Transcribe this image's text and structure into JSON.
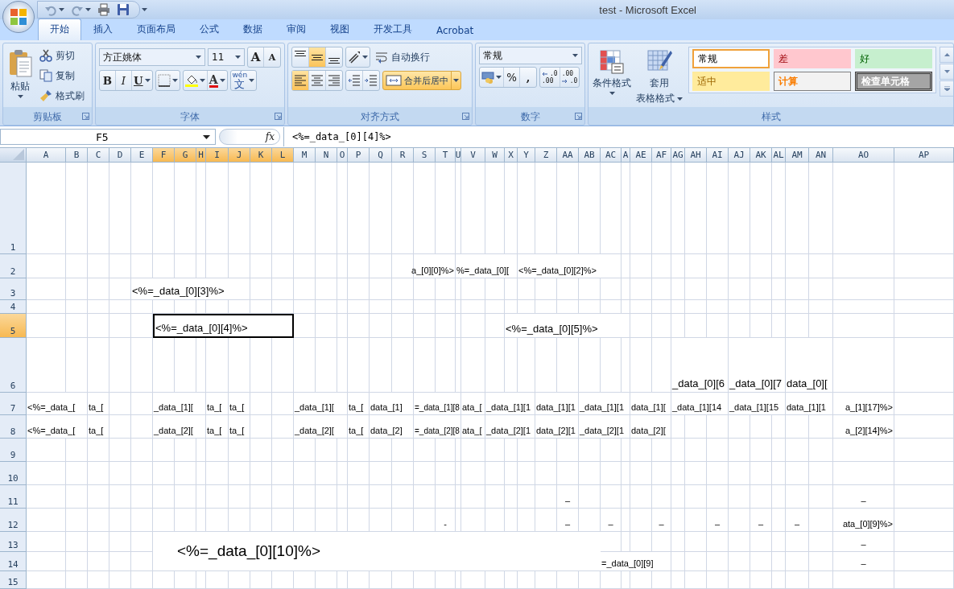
{
  "title_bar": {
    "title": "test - Microsoft Excel"
  },
  "tabs": [
    {
      "label": "开始",
      "selected": true
    },
    {
      "label": "插入",
      "selected": false
    },
    {
      "label": "页面布局",
      "selected": false
    },
    {
      "label": "公式",
      "selected": false
    },
    {
      "label": "数据",
      "selected": false
    },
    {
      "label": "审阅",
      "selected": false
    },
    {
      "label": "视图",
      "selected": false
    },
    {
      "label": "开发工具",
      "selected": false
    },
    {
      "label": "Acrobat",
      "selected": false
    }
  ],
  "ribbon": {
    "groups": [
      {
        "kind": "clipboard",
        "label": "剪贴板",
        "paste": "粘贴",
        "cut": "剪切",
        "copy": "复制",
        "format_painter": "格式刷"
      },
      {
        "kind": "font",
        "label": "字体",
        "font": "方正姚体",
        "size": "11",
        "grow": "A",
        "shrink": "A",
        "bold": "B",
        "italic": "I",
        "underline": "U",
        "font_color": "A",
        "phonetic": "文",
        "phonetic_ruby": "wén"
      },
      {
        "kind": "alignment",
        "label": "对齐方式",
        "vertical": [
          {
            "selected": false
          },
          {
            "selected": true
          },
          {
            "selected": false
          }
        ],
        "horizontal": [
          {
            "selected": true
          },
          {
            "selected": false
          },
          {
            "selected": false
          }
        ],
        "wrap": "自动换行",
        "merge": {
          "label": "合并后居中",
          "selected": true
        }
      },
      {
        "kind": "number",
        "label": "数字",
        "format": "常规",
        "percent": "%",
        "comma": ",",
        "increase_decimal": [
          ".0",
          ".00"
        ],
        "decrease_decimal": [
          ".00",
          ".0"
        ]
      },
      {
        "kind": "styles",
        "label": "样式",
        "conditional": "条件格式",
        "table": [
          "套用",
          "表格格式"
        ],
        "cell_styles": [
          {
            "label": "常规",
            "kind": "normal",
            "selected": true
          },
          {
            "label": "差",
            "kind": "bad",
            "selected": false
          },
          {
            "label": "好",
            "kind": "good",
            "selected": false
          },
          {
            "label": "适中",
            "kind": "neutral",
            "selected": false
          },
          {
            "label": "计算",
            "kind": "calculation",
            "selected": false
          },
          {
            "label": "检查单元格",
            "kind": "check",
            "selected": false
          }
        ]
      }
    ]
  },
  "formula_bar": {
    "name_box": "F5",
    "function_button": "fx",
    "formula": "<%=_data_[0][4]%>"
  },
  "sheet": {
    "columns": [
      {
        "label": "A",
        "selected": false
      },
      {
        "label": "B",
        "selected": false
      },
      {
        "label": "C",
        "selected": false
      },
      {
        "label": "D",
        "selected": false
      },
      {
        "label": "E",
        "selected": false
      },
      {
        "label": "F",
        "selected": true
      },
      {
        "label": "G",
        "selected": true
      },
      {
        "label": "H",
        "selected": true
      },
      {
        "label": "I",
        "selected": true
      },
      {
        "label": "J",
        "selected": true
      },
      {
        "label": "K",
        "selected": true
      },
      {
        "label": "L",
        "selected": true
      },
      {
        "label": "M",
        "selected": false
      },
      {
        "label": "N",
        "selected": false
      },
      {
        "label": "O",
        "selected": false
      },
      {
        "label": "P",
        "selected": false
      },
      {
        "label": "Q",
        "selected": false
      },
      {
        "label": "R",
        "selected": false
      },
      {
        "label": "S",
        "selected": false
      },
      {
        "label": "T",
        "selected": false
      },
      {
        "label": "U",
        "selected": false
      },
      {
        "label": "V",
        "selected": false
      },
      {
        "label": "W",
        "selected": false
      },
      {
        "label": "X",
        "selected": false
      },
      {
        "label": "Y",
        "selected": false
      },
      {
        "label": "Z",
        "selected": false
      },
      {
        "label": "AA",
        "selected": false
      },
      {
        "label": "AB",
        "selected": false
      },
      {
        "label": "AC",
        "selected": false
      },
      {
        "label": "A",
        "selected": false
      },
      {
        "label": "AE",
        "selected": false
      },
      {
        "label": "AF",
        "selected": false
      },
      {
        "label": "AG",
        "selected": false
      },
      {
        "label": "AH",
        "selected": false
      },
      {
        "label": "AI",
        "selected": false
      },
      {
        "label": "AJ",
        "selected": false
      },
      {
        "label": "AK",
        "selected": false
      },
      {
        "label": "AL",
        "selected": false
      },
      {
        "label": "AM",
        "selected": false
      },
      {
        "label": "AN",
        "selected": false
      },
      {
        "label": "AO",
        "selected": false
      },
      {
        "label": "AP",
        "selected": false
      }
    ],
    "rows": [
      {
        "label": "1",
        "selected": false
      },
      {
        "label": "2",
        "selected": false,
        "cells": [
          {
            "kind": "blank"
          },
          {
            "kind": "blank"
          },
          {
            "kind": "blank"
          },
          {
            "kind": "blank"
          },
          {
            "kind": "blank"
          },
          {
            "kind": "blank"
          },
          {
            "kind": "blank"
          },
          {
            "kind": "blank"
          },
          {
            "kind": "blank"
          },
          {
            "kind": "blank"
          },
          {
            "kind": "blank"
          },
          {
            "kind": "blank"
          },
          {
            "kind": "blank"
          },
          {
            "kind": "blank"
          },
          {
            "kind": "blank"
          },
          {
            "kind": "blank"
          },
          {
            "kind": "blank"
          },
          {
            "kind": "blank"
          },
          {
            "kind": "tail",
            "text": "a_[0][0]%>",
            "selected": false
          },
          {
            "kind": "span"
          },
          {
            "kind": "entry",
            "text": "%=_data_[0][",
            "selected": false
          },
          {
            "kind": "span"
          },
          {
            "kind": "span"
          },
          {
            "kind": "span"
          },
          {
            "kind": "entry",
            "text": "<%=_data_[0][2]%>",
            "selected": false
          },
          {
            "kind": "span"
          },
          {
            "kind": "span"
          },
          {
            "kind": "span"
          },
          {
            "kind": "span"
          }
        ]
      },
      {
        "label": "3",
        "selected": false,
        "cells": [
          {
            "kind": "blank"
          },
          {
            "kind": "blank"
          },
          {
            "kind": "blank"
          },
          {
            "kind": "blank"
          },
          {
            "kind": "label",
            "text": "<%=_data_[0][3]%>",
            "selected": false
          },
          {
            "kind": "span"
          },
          {
            "kind": "span"
          },
          {
            "kind": "span"
          },
          {
            "kind": "span"
          },
          {
            "kind": "span"
          }
        ]
      },
      {
        "label": "4",
        "selected": false
      },
      {
        "label": "5",
        "selected": true,
        "cells": [
          {
            "kind": "blank"
          },
          {
            "kind": "blank"
          },
          {
            "kind": "blank"
          },
          {
            "kind": "blank"
          },
          {
            "kind": "blank"
          },
          {
            "kind": "label",
            "text": "<%=_data_[0][4]%>",
            "selected": true
          },
          {
            "kind": "span"
          },
          {
            "kind": "span"
          },
          {
            "kind": "span"
          },
          {
            "kind": "span"
          },
          {
            "kind": "span"
          },
          {
            "kind": "span"
          },
          {
            "kind": "blank"
          },
          {
            "kind": "blank"
          },
          {
            "kind": "blank"
          },
          {
            "kind": "blank"
          },
          {
            "kind": "blank"
          },
          {
            "kind": "blank"
          },
          {
            "kind": "blank"
          },
          {
            "kind": "blank"
          },
          {
            "kind": "blank"
          },
          {
            "kind": "blank"
          },
          {
            "kind": "blank"
          },
          {
            "kind": "label",
            "text": "<%=_data_[0][5]%>",
            "selected": false
          },
          {
            "kind": "span"
          },
          {
            "kind": "span"
          },
          {
            "kind": "span"
          },
          {
            "kind": "span"
          },
          {
            "kind": "span"
          },
          {
            "kind": "span"
          }
        ]
      },
      {
        "label": "6",
        "selected": false,
        "cells": [
          {
            "kind": "blank"
          },
          {
            "kind": "blank"
          },
          {
            "kind": "blank"
          },
          {
            "kind": "blank"
          },
          {
            "kind": "blank"
          },
          {
            "kind": "blank"
          },
          {
            "kind": "blank"
          },
          {
            "kind": "blank"
          },
          {
            "kind": "blank"
          },
          {
            "kind": "blank"
          },
          {
            "kind": "blank"
          },
          {
            "kind": "blank"
          },
          {
            "kind": "blank"
          },
          {
            "kind": "blank"
          },
          {
            "kind": "blank"
          },
          {
            "kind": "blank"
          },
          {
            "kind": "blank"
          },
          {
            "kind": "blank"
          },
          {
            "kind": "blank"
          },
          {
            "kind": "blank"
          },
          {
            "kind": "blank"
          },
          {
            "kind": "blank"
          },
          {
            "kind": "blank"
          },
          {
            "kind": "blank"
          },
          {
            "kind": "blank"
          },
          {
            "kind": "blank"
          },
          {
            "kind": "blank"
          },
          {
            "kind": "blank"
          },
          {
            "kind": "blank"
          },
          {
            "kind": "blank"
          },
          {
            "kind": "blank"
          },
          {
            "kind": "blank"
          },
          {
            "kind": "label",
            "text": "_data_[0][6",
            "selected": false
          },
          {
            "kind": "span"
          },
          {
            "kind": "span"
          },
          {
            "kind": "label",
            "text": "_data_[0][7",
            "selected": false
          },
          {
            "kind": "span"
          },
          {
            "kind": "span"
          },
          {
            "kind": "label",
            "text": "data_[0][",
            "selected": false
          },
          {
            "kind": "span"
          }
        ]
      },
      {
        "label": "7",
        "selected": false,
        "cells": [
          {
            "kind": "entry",
            "text": "<%=_data_[",
            "selected": false
          },
          {
            "kind": "span"
          },
          {
            "kind": "entry",
            "text": "ta_[",
            "selected": false
          },
          {
            "kind": "blank"
          },
          {
            "kind": "blank"
          },
          {
            "kind": "entry",
            "text": "_data_[1][",
            "selected": false
          },
          {
            "kind": "span"
          },
          {
            "kind": "span"
          },
          {
            "kind": "entry",
            "text": "ta_[",
            "selected": false
          },
          {
            "kind": "entry",
            "text": "ta_[",
            "selected": false
          },
          {
            "kind": "blank"
          },
          {
            "kind": "blank"
          },
          {
            "kind": "entry",
            "text": "_data_[1][",
            "selected": false
          },
          {
            "kind": "span"
          },
          {
            "kind": "span"
          },
          {
            "kind": "entry",
            "text": "ta_[",
            "selected": false
          },
          {
            "kind": "entry",
            "text": "data_[1]",
            "selected": false
          },
          {
            "kind": "span"
          },
          {
            "kind": "small",
            "text": "=_data_[1][8",
            "selected": false
          },
          {
            "kind": "span"
          },
          {
            "kind": "span"
          },
          {
            "kind": "entry",
            "text": "ata_[",
            "selected": false
          },
          {
            "kind": "entry",
            "text": "_data_[1][1",
            "selected": false
          },
          {
            "kind": "span"
          },
          {
            "kind": "span"
          },
          {
            "kind": "entry",
            "text": "data_[1][1",
            "selected": false
          },
          {
            "kind": "span"
          },
          {
            "kind": "entry",
            "text": "_data_[1][1",
            "selected": false
          },
          {
            "kind": "span"
          },
          {
            "kind": "span"
          },
          {
            "kind": "entry",
            "text": "data_[1][",
            "selected": false
          },
          {
            "kind": "span"
          },
          {
            "kind": "entry",
            "text": "_data_[1][14",
            "selected": false
          },
          {
            "kind": "span"
          },
          {
            "kind": "span"
          },
          {
            "kind": "entry",
            "text": "_data_[1][15",
            "selected": false
          },
          {
            "kind": "span"
          },
          {
            "kind": "span"
          },
          {
            "kind": "entry",
            "text": "data_[1][1",
            "selected": false
          },
          {
            "kind": "span"
          },
          {
            "kind": "tail",
            "text": "a_[1][17]%>",
            "selected": false
          }
        ]
      },
      {
        "label": "8",
        "selected": false,
        "cells": [
          {
            "kind": "entry",
            "text": "<%=_data_[",
            "selected": false
          },
          {
            "kind": "span"
          },
          {
            "kind": "entry",
            "text": "ta_[",
            "selected": false
          },
          {
            "kind": "blank"
          },
          {
            "kind": "blank"
          },
          {
            "kind": "entry",
            "text": "_data_[2][",
            "selected": false
          },
          {
            "kind": "span"
          },
          {
            "kind": "span"
          },
          {
            "kind": "entry",
            "text": "ta_[",
            "selected": false
          },
          {
            "kind": "entry",
            "text": "ta_[",
            "selected": false
          },
          {
            "kind": "blank"
          },
          {
            "kind": "blank"
          },
          {
            "kind": "entry",
            "text": "_data_[2][",
            "selected": false
          },
          {
            "kind": "span"
          },
          {
            "kind": "span"
          },
          {
            "kind": "entry",
            "text": "ta_[",
            "selected": false
          },
          {
            "kind": "entry",
            "text": "data_[2]",
            "selected": false
          },
          {
            "kind": "span"
          },
          {
            "kind": "small",
            "text": "=_data_[2][8",
            "selected": false
          },
          {
            "kind": "span"
          },
          {
            "kind": "span"
          },
          {
            "kind": "entry",
            "text": "ata_[",
            "selected": false
          },
          {
            "kind": "entry",
            "text": "_data_[2][1",
            "selected": false
          },
          {
            "kind": "span"
          },
          {
            "kind": "span"
          },
          {
            "kind": "entry",
            "text": "data_[2][1",
            "selected": false
          },
          {
            "kind": "span"
          },
          {
            "kind": "entry",
            "text": "_data_[2][1",
            "selected": false
          },
          {
            "kind": "span"
          },
          {
            "kind": "span"
          },
          {
            "kind": "entry",
            "text": "data_[2][",
            "selected": false
          },
          {
            "kind": "span"
          },
          {
            "kind": "blank"
          },
          {
            "kind": "blank"
          },
          {
            "kind": "blank"
          },
          {
            "kind": "blank"
          },
          {
            "kind": "blank"
          },
          {
            "kind": "blank"
          },
          {
            "kind": "blank"
          },
          {
            "kind": "blank"
          },
          {
            "kind": "tail",
            "text": "a_[2][14]%>",
            "selected": false
          }
        ]
      },
      {
        "label": "9",
        "selected": false
      },
      {
        "label": "10",
        "selected": false
      },
      {
        "label": "11",
        "selected": false,
        "cells": [
          {
            "kind": "blank"
          },
          {
            "kind": "blank"
          },
          {
            "kind": "blank"
          },
          {
            "kind": "blank"
          },
          {
            "kind": "blank"
          },
          {
            "kind": "blank"
          },
          {
            "kind": "blank"
          },
          {
            "kind": "blank"
          },
          {
            "kind": "blank"
          },
          {
            "kind": "blank"
          },
          {
            "kind": "blank"
          },
          {
            "kind": "blank"
          },
          {
            "kind": "blank"
          },
          {
            "kind": "blank"
          },
          {
            "kind": "blank"
          },
          {
            "kind": "blank"
          },
          {
            "kind": "blank"
          },
          {
            "kind": "blank"
          },
          {
            "kind": "blank"
          },
          {
            "kind": "blank"
          },
          {
            "kind": "blank"
          },
          {
            "kind": "blank"
          },
          {
            "kind": "blank"
          },
          {
            "kind": "blank"
          },
          {
            "kind": "blank"
          },
          {
            "kind": "blank"
          },
          {
            "kind": "dash",
            "text": "–",
            "selected": false
          },
          {
            "kind": "blank"
          },
          {
            "kind": "blank"
          },
          {
            "kind": "blank"
          },
          {
            "kind": "blank"
          },
          {
            "kind": "blank"
          },
          {
            "kind": "blank"
          },
          {
            "kind": "blank"
          },
          {
            "kind": "blank"
          },
          {
            "kind": "blank"
          },
          {
            "kind": "blank"
          },
          {
            "kind": "blank"
          },
          {
            "kind": "blank"
          },
          {
            "kind": "blank"
          },
          {
            "kind": "dash",
            "text": "–",
            "selected": false
          }
        ]
      },
      {
        "label": "12",
        "selected": false,
        "cells": [
          {
            "kind": "blank"
          },
          {
            "kind": "blank"
          },
          {
            "kind": "blank"
          },
          {
            "kind": "blank"
          },
          {
            "kind": "blank"
          },
          {
            "kind": "blank"
          },
          {
            "kind": "blank"
          },
          {
            "kind": "blank"
          },
          {
            "kind": "blank"
          },
          {
            "kind": "blank"
          },
          {
            "kind": "blank"
          },
          {
            "kind": "blank"
          },
          {
            "kind": "blank"
          },
          {
            "kind": "blank"
          },
          {
            "kind": "blank"
          },
          {
            "kind": "blank"
          },
          {
            "kind": "blank"
          },
          {
            "kind": "blank"
          },
          {
            "kind": "blank"
          },
          {
            "kind": "dash",
            "text": "-",
            "selected": false
          },
          {
            "kind": "blank"
          },
          {
            "kind": "blank"
          },
          {
            "kind": "blank"
          },
          {
            "kind": "blank"
          },
          {
            "kind": "blank"
          },
          {
            "kind": "blank"
          },
          {
            "kind": "dash",
            "text": "–",
            "selected": false
          },
          {
            "kind": "blank"
          },
          {
            "kind": "dash",
            "text": "–",
            "selected": false
          },
          {
            "kind": "blank"
          },
          {
            "kind": "blank"
          },
          {
            "kind": "dash",
            "text": "–",
            "selected": false
          },
          {
            "kind": "blank"
          },
          {
            "kind": "blank"
          },
          {
            "kind": "dash",
            "text": "–",
            "selected": false
          },
          {
            "kind": "blank"
          },
          {
            "kind": "dash",
            "text": "–",
            "selected": false
          },
          {
            "kind": "blank"
          },
          {
            "kind": "dash",
            "text": "–",
            "selected": false
          },
          {
            "kind": "blank"
          },
          {
            "kind": "tail",
            "text": "ata_[0][9]%>",
            "selected": false
          }
        ]
      },
      {
        "label": "13",
        "selected": false,
        "cells": [
          {
            "kind": "blank"
          },
          {
            "kind": "blank"
          },
          {
            "kind": "blank"
          },
          {
            "kind": "blank"
          },
          {
            "kind": "blank"
          },
          {
            "kind": "title",
            "text": "<%=_data_[0][10]%>",
            "selected": false
          },
          {
            "kind": "span"
          },
          {
            "kind": "span"
          },
          {
            "kind": "span"
          },
          {
            "kind": "span"
          },
          {
            "kind": "span"
          },
          {
            "kind": "span"
          },
          {
            "kind": "span"
          },
          {
            "kind": "span"
          },
          {
            "kind": "span"
          },
          {
            "kind": "span"
          },
          {
            "kind": "span"
          },
          {
            "kind": "span"
          },
          {
            "kind": "span"
          },
          {
            "kind": "span"
          },
          {
            "kind": "span"
          },
          {
            "kind": "span"
          },
          {
            "kind": "span"
          },
          {
            "kind": "span"
          },
          {
            "kind": "span"
          },
          {
            "kind": "span"
          },
          {
            "kind": "span"
          },
          {
            "kind": "span"
          },
          {
            "kind": "blank"
          },
          {
            "kind": "blank"
          },
          {
            "kind": "blank"
          },
          {
            "kind": "blank"
          },
          {
            "kind": "blank"
          },
          {
            "kind": "blank"
          },
          {
            "kind": "blank"
          },
          {
            "kind": "blank"
          },
          {
            "kind": "blank"
          },
          {
            "kind": "blank"
          },
          {
            "kind": "blank"
          },
          {
            "kind": "blank"
          },
          {
            "kind": "dash",
            "text": "–",
            "selected": false
          }
        ]
      },
      {
        "label": "14",
        "selected": false,
        "cells": [
          {
            "kind": "blank"
          },
          {
            "kind": "blank"
          },
          {
            "kind": "blank"
          },
          {
            "kind": "blank"
          },
          {
            "kind": "blank"
          },
          {
            "kind": "cover"
          },
          {
            "kind": "cover"
          },
          {
            "kind": "cover"
          },
          {
            "kind": "cover"
          },
          {
            "kind": "cover"
          },
          {
            "kind": "cover"
          },
          {
            "kind": "cover"
          },
          {
            "kind": "cover"
          },
          {
            "kind": "cover"
          },
          {
            "kind": "cover"
          },
          {
            "kind": "cover"
          },
          {
            "kind": "cover"
          },
          {
            "kind": "cover"
          },
          {
            "kind": "cover"
          },
          {
            "kind": "cover"
          },
          {
            "kind": "cover"
          },
          {
            "kind": "cover"
          },
          {
            "kind": "cover"
          },
          {
            "kind": "cover"
          },
          {
            "kind": "cover"
          },
          {
            "kind": "cover"
          },
          {
            "kind": "cover"
          },
          {
            "kind": "cover"
          },
          {
            "kind": "entry",
            "text": "=_data_[0][9]",
            "selected": false
          },
          {
            "kind": "span"
          },
          {
            "kind": "span"
          },
          {
            "kind": "span"
          },
          {
            "kind": "blank"
          },
          {
            "kind": "blank"
          },
          {
            "kind": "blank"
          },
          {
            "kind": "blank"
          },
          {
            "kind": "blank"
          },
          {
            "kind": "blank"
          },
          {
            "kind": "blank"
          },
          {
            "kind": "blank"
          },
          {
            "kind": "dash",
            "text": "–",
            "selected": false
          }
        ]
      },
      {
        "label": "15",
        "selected": false
      }
    ]
  }
}
